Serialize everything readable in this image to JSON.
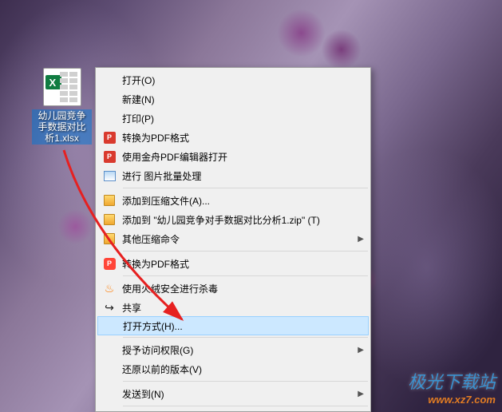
{
  "desktop": {
    "file_label": "幼儿园竞争手数据对比析1.xlsx"
  },
  "menu": {
    "open": "打开(O)",
    "new": "新建(N)",
    "print": "打印(P)",
    "to_pdf1": "转换为PDF格式",
    "jinzhou_pdf": "使用金舟PDF编辑器打开",
    "img_proc": "进行 图片批量处理",
    "add_archive": "添加到压缩文件(A)...",
    "add_zip": "添加到 \"幼儿园竞争对手数据对比分析1.zip\" (T)",
    "other_zip": "其他压缩命令",
    "to_pdf2": "转换为PDF格式",
    "huorong": "使用火绒安全进行杀毒",
    "share": "共享",
    "open_with": "打开方式(H)...",
    "grant_access": "授予访问权限(G)",
    "restore": "还原以前的版本(V)",
    "send_to": "发送到(N)"
  },
  "watermark": {
    "cn": "极光下载站",
    "en": "www.xz7.com"
  }
}
